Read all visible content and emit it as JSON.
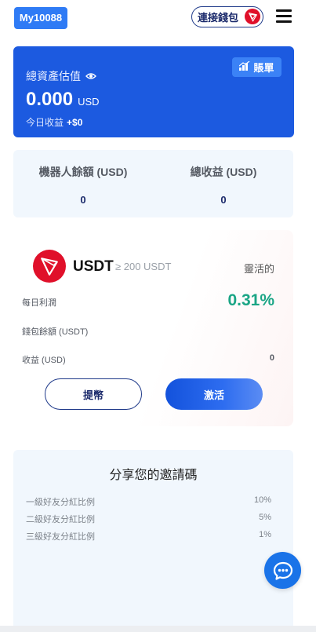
{
  "header": {
    "brand": "My10088",
    "connect_label": "連接錢包"
  },
  "asset": {
    "title": "總資產估值",
    "value": "0.000",
    "unit": "USD",
    "today_label": "今日收益",
    "today_value": "+$0",
    "bill_label": "賬單"
  },
  "stats": {
    "robot_balance_label": "機器人餘額 (USD)",
    "robot_balance_value": "0",
    "total_income_label": "總收益 (USD)",
    "total_income_value": "0"
  },
  "usdt": {
    "coin": "USDT",
    "min": "≥ 200 USDT",
    "tag": "靈活的",
    "daily_profit_label": "每日利潤",
    "daily_profit_value": "0.31%",
    "wallet_balance_label": "錢包餘額 (USDT)",
    "income_label": "收益 (USD)",
    "income_value": "0",
    "withdraw_label": "提幣",
    "activate_label": "激活"
  },
  "invite": {
    "title": "分享您的邀請碼",
    "rows": [
      {
        "label": "一級好友分紅比例",
        "value": "10%"
      },
      {
        "label": "二級好友分紅比例",
        "value": "5%"
      },
      {
        "label": "三級好友分紅比例",
        "value": "1%"
      }
    ]
  },
  "icons": {
    "eye": "eye-icon",
    "bill": "chart-bars-icon",
    "tron": "tron-logo-icon",
    "menu": "hamburger-menu-icon",
    "chat": "chat-bubble-icon"
  },
  "colors": {
    "primary": "#1c5ae0",
    "accent_green": "#1aa585",
    "tron_red": "#e0102a",
    "navy": "#1b2a6b"
  }
}
